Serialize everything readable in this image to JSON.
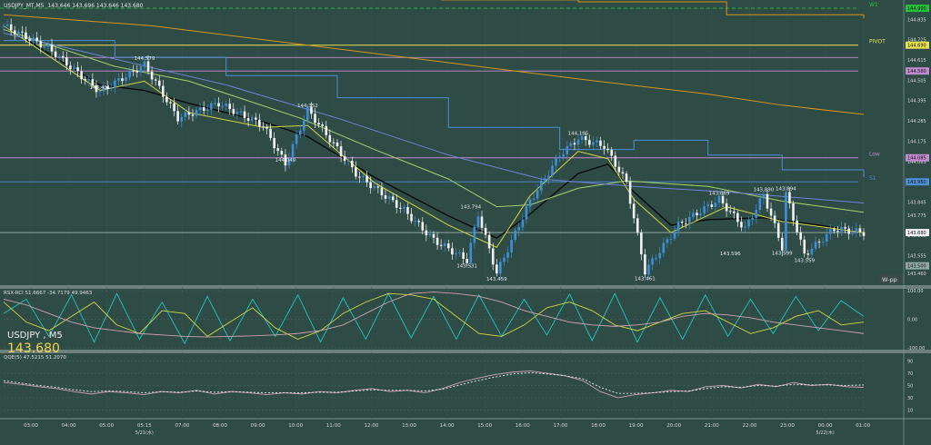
{
  "header": {
    "symbol": "USDJPY_MT,M5",
    "ohlc": "143.646 143.696 143.646 143.680",
    "wpp_tag": "W-pp"
  },
  "info_box": {
    "symbol": "USDJPY , M5",
    "price": "143.680"
  },
  "indicator1_label": "RSX-RCI  51.6667  -34.7179  49.9463",
  "indicator2_label": "QQE(5)  47.5215  51.2070",
  "colors": {
    "background": "#2e4b45",
    "bull": "#3f8fd8",
    "bear": "#f2f2f2",
    "ma_black": "#0b0b0b",
    "ma_yellow": "#d4d840",
    "ma_green": "#a7d06a",
    "ma_blue": "#6d86d9",
    "ma_orange": "#d7951f",
    "step_blue": "#4c8fd6",
    "pivot": "#e7e24f",
    "violet": "#c18bd0",
    "cyan": "#23c6c0",
    "qqe": "#cfa3b0"
  },
  "chart_data": [
    {
      "type": "candlestick",
      "title": "USDJPY_MT,M5",
      "x_tick_labels": [
        "03:00",
        "04:00",
        "05:00",
        "05:15",
        "07:00",
        "08:00",
        "09:00",
        "10:00",
        "11:00",
        "12:00",
        "13:00",
        "14:00",
        "15:00",
        "16:00",
        "17:00",
        "18:00",
        "19:00",
        "20:00",
        "21:00",
        "22:00",
        "23:00",
        "00:00",
        "01:00"
      ],
      "x_date_labels": [
        {
          "at_tick": 3,
          "text": "5/21(水)"
        },
        {
          "at_tick": 21,
          "text": "5/22(木)"
        }
      ],
      "ylim": [
        143.4,
        144.92
      ],
      "price_scale": [
        "144.835",
        "144.725",
        "144.615",
        "144.505",
        "144.395",
        "144.285",
        "144.175",
        "144.065",
        "143.955",
        "143.845",
        "143.775",
        "143.665",
        "143.555",
        "143.460"
      ],
      "price_tags": [
        {
          "text": "144.900",
          "value": 144.895,
          "color": "#27c23a"
        },
        {
          "text": "144.690",
          "value": 144.695,
          "color": "#e7e24f"
        },
        {
          "text": "144.580",
          "value": 144.555,
          "color": "#c18bd0"
        },
        {
          "text": "144.085",
          "value": 144.085,
          "color": "#c18bd0"
        },
        {
          "text": "143.950",
          "value": 143.955,
          "color": "#4c8fd6"
        },
        {
          "text": "143.680",
          "value": 143.68,
          "color": "#f2f2f2"
        },
        {
          "text": "143.500",
          "value": 143.5,
          "color": "#8fa8a3"
        }
      ],
      "levels": [
        {
          "name": "W1",
          "value": 144.895,
          "color": "#27c23a",
          "dashed": true
        },
        {
          "name": "PIVOT",
          "value": 144.695,
          "color": "#e7e24f"
        },
        {
          "name": "",
          "value": 144.628,
          "color": "#c18bd0"
        },
        {
          "name": "",
          "value": 144.555,
          "color": "#c18bd0"
        },
        {
          "name": "Low",
          "value": 144.085,
          "color": "#c18bd0"
        },
        {
          "name": "S1",
          "value": 143.955,
          "color": "#4c8fd6"
        },
        {
          "name": "",
          "value": 143.68,
          "color": "#9fb3ae"
        }
      ],
      "annotations": [
        {
          "text": "144.431",
          "t": 26,
          "value": 144.442
        },
        {
          "text": "144.579",
          "t": 38,
          "value": 144.6
        },
        {
          "text": "144.352",
          "t": 82,
          "value": 144.345
        },
        {
          "text": "144.049",
          "t": 76,
          "value": 144.05
        },
        {
          "text": "143.794",
          "t": 126,
          "value": 143.795
        },
        {
          "text": "143.531",
          "t": 125,
          "value": 143.531
        },
        {
          "text": "143.459",
          "t": 133,
          "value": 143.459
        },
        {
          "text": "144.195",
          "t": 155,
          "value": 144.195
        },
        {
          "text": "143.461",
          "t": 173,
          "value": 143.461
        },
        {
          "text": "143.869",
          "t": 193,
          "value": 143.869
        },
        {
          "text": "143.890",
          "t": 205,
          "value": 143.89
        },
        {
          "text": "143.894",
          "t": 211,
          "value": 143.894
        },
        {
          "text": "143.596",
          "t": 196,
          "value": 143.596
        },
        {
          "text": "143.599",
          "t": 210,
          "value": 143.599
        },
        {
          "text": "143.559",
          "t": 216,
          "value": 143.559
        }
      ],
      "close_path": [
        {
          "t": 0,
          "p": 144.8
        },
        {
          "t": 12,
          "p": 144.68
        },
        {
          "t": 26,
          "p": 144.442
        },
        {
          "t": 38,
          "p": 144.59
        },
        {
          "t": 47,
          "p": 144.3
        },
        {
          "t": 58,
          "p": 144.38
        },
        {
          "t": 70,
          "p": 144.26
        },
        {
          "t": 76,
          "p": 144.05
        },
        {
          "t": 82,
          "p": 144.345
        },
        {
          "t": 95,
          "p": 144.0
        },
        {
          "t": 108,
          "p": 143.8
        },
        {
          "t": 116,
          "p": 143.64
        },
        {
          "t": 125,
          "p": 143.531
        },
        {
          "t": 128,
          "p": 143.78
        },
        {
          "t": 133,
          "p": 143.46
        },
        {
          "t": 142,
          "p": 143.85
        },
        {
          "t": 150,
          "p": 144.1
        },
        {
          "t": 155,
          "p": 144.19
        },
        {
          "t": 162,
          "p": 144.15
        },
        {
          "t": 168,
          "p": 143.95
        },
        {
          "t": 173,
          "p": 143.47
        },
        {
          "t": 182,
          "p": 143.72
        },
        {
          "t": 193,
          "p": 143.86
        },
        {
          "t": 200,
          "p": 143.7
        },
        {
          "t": 205,
          "p": 143.885
        },
        {
          "t": 210,
          "p": 143.6
        },
        {
          "t": 211,
          "p": 143.89
        },
        {
          "t": 216,
          "p": 143.56
        },
        {
          "t": 224,
          "p": 143.7
        },
        {
          "t": 232,
          "p": 143.68
        }
      ],
      "moving_averages": [
        {
          "color": "#0b0b0b",
          "points": [
            [
              0,
              144.8
            ],
            [
              26,
              144.48
            ],
            [
              38,
              144.45
            ],
            [
              50,
              144.38
            ],
            [
              70,
              144.28
            ],
            [
              82,
              144.2
            ],
            [
              100,
              143.98
            ],
            [
              120,
              143.77
            ],
            [
              133,
              143.65
            ],
            [
              142,
              143.78
            ],
            [
              155,
              144.0
            ],
            [
              163,
              144.05
            ],
            [
              170,
              143.9
            ],
            [
              180,
              143.72
            ],
            [
              190,
              143.75
            ],
            [
              205,
              143.76
            ],
            [
              220,
              143.72
            ],
            [
              232,
              143.68
            ]
          ]
        },
        {
          "color": "#d4d840",
          "points": [
            [
              0,
              144.8
            ],
            [
              26,
              144.45
            ],
            [
              38,
              144.5
            ],
            [
              50,
              144.33
            ],
            [
              70,
              144.25
            ],
            [
              82,
              144.26
            ],
            [
              100,
              143.95
            ],
            [
              120,
              143.72
            ],
            [
              133,
              143.6
            ],
            [
              142,
              143.88
            ],
            [
              155,
              144.12
            ],
            [
              163,
              144.08
            ],
            [
              170,
              143.86
            ],
            [
              180,
              143.68
            ],
            [
              195,
              143.82
            ],
            [
              210,
              143.74
            ],
            [
              232,
              143.68
            ]
          ]
        },
        {
          "color": "#a7d06a",
          "points": [
            [
              0,
              144.78
            ],
            [
              30,
              144.58
            ],
            [
              50,
              144.5
            ],
            [
              80,
              144.3
            ],
            [
              100,
              144.13
            ],
            [
              120,
              143.97
            ],
            [
              133,
              143.82
            ],
            [
              142,
              143.83
            ],
            [
              155,
              143.92
            ],
            [
              168,
              143.96
            ],
            [
              190,
              143.93
            ],
            [
              210,
              143.85
            ],
            [
              232,
              143.79
            ]
          ]
        },
        {
          "color": "#6d86d9",
          "points": [
            [
              0,
              144.76
            ],
            [
              30,
              144.62
            ],
            [
              60,
              144.48
            ],
            [
              90,
              144.3
            ],
            [
              120,
              144.1
            ],
            [
              145,
              143.97
            ],
            [
              170,
              143.93
            ],
            [
              195,
              143.9
            ],
            [
              220,
              143.86
            ],
            [
              232,
              143.84
            ]
          ]
        },
        {
          "color": "#d7951f",
          "points": [
            [
              0,
              144.86
            ],
            [
              40,
              144.8
            ],
            [
              80,
              144.7
            ],
            [
              120,
              144.6
            ],
            [
              160,
              144.5
            ],
            [
              190,
              144.43
            ],
            [
              210,
              144.37
            ],
            [
              232,
              144.32
            ]
          ]
        }
      ],
      "step_lines": [
        {
          "color": "#4c8fd6",
          "points": [
            [
              0,
              144.72
            ],
            [
              30,
              144.63
            ],
            [
              60,
              144.53
            ],
            [
              90,
              144.41
            ],
            [
              120,
              144.25
            ],
            [
              150,
              144.13
            ],
            [
              170,
              144.18
            ],
            [
              190,
              144.1
            ],
            [
              210,
              144.02
            ],
            [
              232,
              143.98
            ]
          ]
        },
        {
          "color": "#d7951f",
          "points": [
            [
              118,
              144.94
            ],
            [
              155,
              144.93
            ],
            [
              195,
              144.86
            ],
            [
              232,
              144.84
            ]
          ]
        }
      ]
    },
    {
      "type": "line",
      "title": "RSX-RCI 51.6667 -34.7179 49.9463",
      "ylim": [
        -100,
        100
      ],
      "y_tick_labels": [
        "100.00",
        "0.00",
        "-100.00"
      ],
      "series": [
        {
          "color": "#23c6c0",
          "values": [
            20,
            70,
            -60,
            85,
            -80,
            90,
            -70,
            60,
            -85,
            80,
            -75,
            70,
            -60,
            85,
            -80,
            75,
            -70,
            90,
            -65,
            80,
            -70,
            85,
            -60,
            70,
            -55,
            88,
            -75,
            90,
            -80,
            75,
            -70,
            85,
            -60,
            70,
            -50,
            80,
            -40,
            65,
            10
          ]
        },
        {
          "color": "#d4d840",
          "values": [
            60,
            -10,
            -40,
            10,
            60,
            -20,
            -50,
            30,
            20,
            -60,
            -10,
            40,
            -30,
            -70,
            -40,
            20,
            60,
            90,
            85,
            70,
            10,
            -50,
            -60,
            -20,
            40,
            60,
            30,
            -20,
            -40,
            -10,
            20,
            30,
            -10,
            -50,
            -30,
            10,
            30,
            -20,
            -10
          ]
        },
        {
          "color": "#cfa3b0",
          "values": [
            70,
            50,
            20,
            -10,
            -30,
            -40,
            -50,
            -55,
            -60,
            -62,
            -60,
            -58,
            -55,
            -50,
            -40,
            -20,
            20,
            60,
            90,
            95,
            90,
            80,
            60,
            30,
            10,
            -10,
            -20,
            -25,
            -20,
            -10,
            10,
            20,
            15,
            5,
            -10,
            -20,
            -30,
            -40,
            -50
          ]
        }
      ]
    },
    {
      "type": "line",
      "title": "QQE(5) 47.5215 51.2070",
      "ylim": [
        0,
        100
      ],
      "y_tick_labels": [
        "90",
        "70",
        "50",
        "30",
        "10"
      ],
      "series": [
        {
          "color": "#cfa3b0",
          "values": [
            55,
            52,
            48,
            45,
            40,
            36,
            40,
            38,
            35,
            40,
            38,
            42,
            36,
            40,
            38,
            35,
            38,
            36,
            40,
            38,
            42,
            45,
            40,
            42,
            38,
            45,
            55,
            62,
            68,
            72,
            74,
            70,
            66,
            58,
            40,
            30,
            35,
            38,
            42,
            40,
            48,
            50,
            46,
            52,
            48,
            55,
            50,
            52,
            48,
            47
          ]
        },
        {
          "color": "#f2f2f2",
          "dashed": true,
          "values": [
            58,
            54,
            50,
            47,
            43,
            40,
            41,
            40,
            38,
            40,
            39,
            41,
            39,
            40,
            39,
            38,
            38,
            38,
            39,
            39,
            41,
            43,
            42,
            42,
            41,
            44,
            51,
            58,
            64,
            69,
            71,
            69,
            66,
            61,
            47,
            37,
            37,
            38,
            40,
            41,
            45,
            48,
            47,
            50,
            49,
            52,
            51,
            51,
            50,
            51
          ]
        }
      ]
    }
  ]
}
